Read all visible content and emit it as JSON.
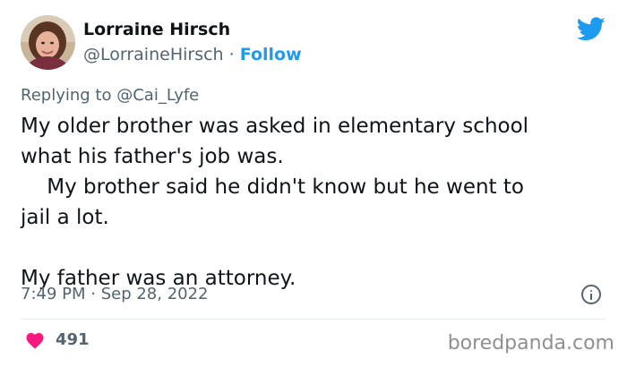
{
  "author": {
    "name": "Lorraine Hirsch",
    "handle": "@LorraineHirsch",
    "separator": "·",
    "follow_label": "Follow"
  },
  "reply": {
    "prefix": "Replying to",
    "handle": "@Cai_Lyfe"
  },
  "tweet": {
    "text": "My older brother was asked in elementary school\nwhat his father's job was.\n    My brother said he didn't know but he went to\njail a lot.\n\nMy father was an attorney."
  },
  "meta": {
    "timestamp": "7:49 PM · Sep 28, 2022"
  },
  "stats": {
    "likes": "491"
  },
  "watermark": "boredpanda.com",
  "colors": {
    "twitter_blue": "#1d9bf0",
    "like_pink": "#f91880",
    "secondary_text": "#536471"
  },
  "icons": {
    "brand": "twitter-bird-icon",
    "info": "info-icon",
    "like": "heart-icon"
  }
}
